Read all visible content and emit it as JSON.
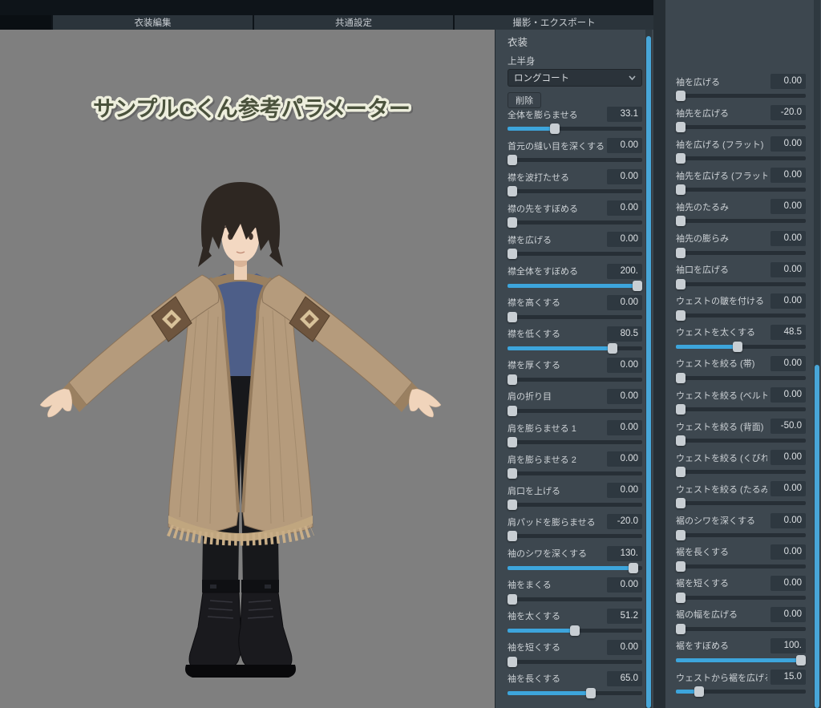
{
  "colors": {
    "accent": "#3da5dc",
    "panel": "#3d474f",
    "viewport_bg": "#7f7f7f"
  },
  "tabs": [
    {
      "label": "衣装編集"
    },
    {
      "label": "共通設定"
    },
    {
      "label": "撮影・エクスポート"
    }
  ],
  "viewport": {
    "overlay_title": "サンプルCくん参考パラメーター"
  },
  "costume_panel": {
    "header": "衣装",
    "section_label": "上半身",
    "item_select": {
      "value": "ロングコート"
    },
    "delete_button": "削除",
    "sliders": [
      {
        "label": "全体を膨らませる",
        "value": "33.1",
        "fill": 0.34
      },
      {
        "label": "首元の縫い目を深くする",
        "value": "0.00",
        "fill": 0
      },
      {
        "label": "襟を波打たせる",
        "value": "0.00",
        "fill": 0
      },
      {
        "label": "襟の先をすぼめる",
        "value": "0.00",
        "fill": 0
      },
      {
        "label": "襟を広げる",
        "value": "0.00",
        "fill": 0
      },
      {
        "label": "襟全体をすぼめる",
        "value": "200.",
        "fill": 1
      },
      {
        "label": "襟を高くする",
        "value": "0.00",
        "fill": 0
      },
      {
        "label": "襟を低くする",
        "value": "80.5",
        "fill": 0.8
      },
      {
        "label": "襟を厚くする",
        "value": "0.00",
        "fill": 0
      },
      {
        "label": "肩の折り目",
        "value": "0.00",
        "fill": 0
      },
      {
        "label": "肩を膨らませる 1",
        "value": "0.00",
        "fill": 0
      },
      {
        "label": "肩を膨らませる 2",
        "value": "0.00",
        "fill": 0
      },
      {
        "label": "肩口を上げる",
        "value": "0.00",
        "fill": 0
      },
      {
        "label": "肩パッドを膨らませる",
        "value": "-20.0",
        "fill": 0
      },
      {
        "label": "袖のシワを深くする",
        "value": "130.",
        "fill": 0.97
      },
      {
        "label": "袖をまくる",
        "value": "0.00",
        "fill": 0
      },
      {
        "label": "袖を太くする",
        "value": "51.2",
        "fill": 0.5
      },
      {
        "label": "袖を短くする",
        "value": "0.00",
        "fill": 0
      },
      {
        "label": "袖を長くする",
        "value": "65.0",
        "fill": 0.63
      }
    ]
  },
  "detail_panel": {
    "sliders": [
      {
        "label": "袖を広げる",
        "value": "0.00",
        "fill": 0
      },
      {
        "label": "袖先を広げる",
        "value": "-20.0",
        "fill": 0
      },
      {
        "label": "袖を広げる (フラット)",
        "value": "0.00",
        "fill": 0
      },
      {
        "label": "袖先を広げる (フラット)",
        "value": "0.00",
        "fill": 0
      },
      {
        "label": "袖先のたるみ",
        "value": "0.00",
        "fill": 0
      },
      {
        "label": "袖先の膨らみ",
        "value": "0.00",
        "fill": 0
      },
      {
        "label": "袖口を広げる",
        "value": "0.00",
        "fill": 0
      },
      {
        "label": "ウェストの皺を付ける",
        "value": "0.00",
        "fill": 0
      },
      {
        "label": "ウェストを太くする",
        "value": "48.5",
        "fill": 0.47
      },
      {
        "label": "ウェストを絞る (帯)",
        "value": "0.00",
        "fill": 0
      },
      {
        "label": "ウェストを絞る (ベルト)",
        "value": "0.00",
        "fill": 0
      },
      {
        "label": "ウェストを絞る (背面)",
        "value": "-50.0",
        "fill": 0
      },
      {
        "label": "ウェストを絞る (くびれ)",
        "value": "0.00",
        "fill": 0
      },
      {
        "label": "ウェストを絞る (たるみ)",
        "value": "0.00",
        "fill": 0
      },
      {
        "label": "裾のシワを深くする",
        "value": "0.00",
        "fill": 0
      },
      {
        "label": "裾を長くする",
        "value": "0.00",
        "fill": 0
      },
      {
        "label": "裾を短くする",
        "value": "0.00",
        "fill": 0
      },
      {
        "label": "裾の幅を広げる",
        "value": "0.00",
        "fill": 0
      },
      {
        "label": "裾をすぼめる",
        "value": "100.",
        "fill": 1
      },
      {
        "label": "ウェストから裾を広げる",
        "value": "15.0",
        "fill": 0.15
      }
    ]
  }
}
